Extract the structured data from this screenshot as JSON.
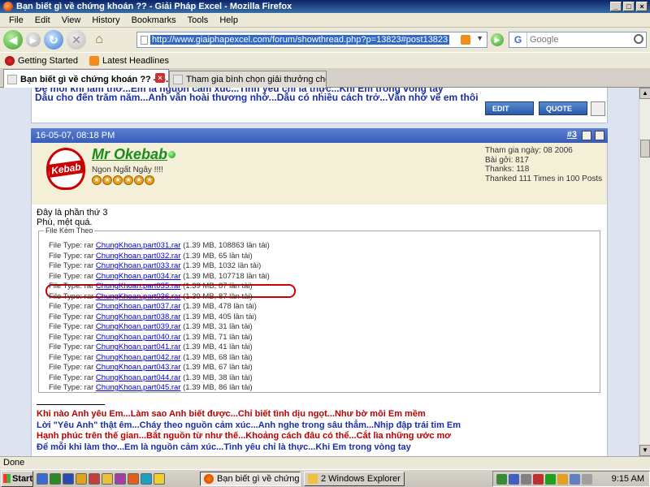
{
  "window": {
    "title": "Bạn biết gì về chứng khoán ?? - Giải Pháp Excel - Mozilla Firefox",
    "controls": [
      "_",
      "□",
      "×"
    ]
  },
  "menu": [
    "File",
    "Edit",
    "View",
    "History",
    "Bookmarks",
    "Tools",
    "Help"
  ],
  "nav": {
    "url": "http://www.giaiphapexcel.com/forum/showthread.php?p=13823#post13823",
    "search_placeholder": "Google",
    "search_engine_letter": "G"
  },
  "bookmarks": [
    {
      "label": "Getting Started",
      "icon": "firefox-icon"
    },
    {
      "label": "Latest Headlines",
      "icon": "rss-icon"
    }
  ],
  "tabs": [
    {
      "label": "Bạn biết gì về chứng khoán ?? - G...",
      "active": true
    },
    {
      "label": "Tham gia bình chọn giải thưởng cho ng...",
      "active": false
    }
  ],
  "previous_post": {
    "sig_line1": "Để mỗi khi làm thơ...Em là nguồn cảm xúc...Tình yêu chỉ là thực...Khi Em trong vòng tay",
    "sig_line2": "Dẫu cho đến trăm năm...Anh vẫn hoài thương nhớ...Dẫu có nhiều cách trở...Vẫn nhớ về em thôi",
    "edit_label": "EDIT",
    "quote_label": "QUOTE"
  },
  "post": {
    "datetime": "16-05-07, 08:18 PM",
    "number": "#3",
    "username": "Mr Okebab",
    "user_title": "Ngon Ngất Ngây !!!!",
    "logo_text": "Kebab",
    "stars": 6,
    "stats": [
      "Tham gia ngày: 08 2006",
      "Bài gởi: 817",
      "Thanks: 118",
      "Thanked 111 Times in 100 Posts"
    ],
    "message_line1": "Đây là phần thứ 3",
    "message_line2": "Phù, mệt quá.",
    "attachments_legend": "File Kèm Theo",
    "file_type_label": "File Type: rar",
    "attachments": [
      {
        "name": "ChungKhoan.part031.rar",
        "info": "(1.39 MB, 108863 lần tải)"
      },
      {
        "name": "ChungKhoan.part032.rar",
        "info": "(1.39 MB, 65 lần tải)"
      },
      {
        "name": "ChungKhoan.part033.rar",
        "info": "(1.39 MB, 1032 lần tải)"
      },
      {
        "name": "ChungKhoan.part034.rar",
        "info": "(1.39 MB, 107718 lần tải)"
      },
      {
        "name": "ChungKhoan.part035.rar",
        "info": "(1.39 MB, 87 lần tải)"
      },
      {
        "name": "ChungKhoan.part036.rar",
        "info": "(1.39 MB, 87 lần tải)"
      },
      {
        "name": "ChungKhoan.part037.rar",
        "info": "(1.39 MB, 478 lần tải)"
      },
      {
        "name": "ChungKhoan.part038.rar",
        "info": "(1.39 MB, 405 lần tải)"
      },
      {
        "name": "ChungKhoan.part039.rar",
        "info": "(1.39 MB, 31 lần tải)"
      },
      {
        "name": "ChungKhoan.part040.rar",
        "info": "(1.39 MB, 71 lần tải)"
      },
      {
        "name": "ChungKhoan.part041.rar",
        "info": "(1.39 MB, 41 lần tải)"
      },
      {
        "name": "ChungKhoan.part042.rar",
        "info": "(1.39 MB, 68 lần tải)"
      },
      {
        "name": "ChungKhoan.part043.rar",
        "info": "(1.39 MB, 67 lần tải)"
      },
      {
        "name": "ChungKhoan.part044.rar",
        "info": "(1.39 MB, 38 lần tải)"
      },
      {
        "name": "ChungKhoan.part045.rar",
        "info": "(1.39 MB, 86 lần tải)"
      }
    ],
    "highlighted_attachment_index": 3,
    "signature": [
      {
        "text": "Khi nào Anh yêu Em...Làm sao Anh biết được...Chỉ biết tình dịu ngọt...Như bờ môi Em mềm",
        "color": "red"
      },
      {
        "text": "Lời \"Yêu Anh\" thật êm...Cháy theo nguồn cảm xúc...Anh nghe trong sâu thẳm...Nhịp đập trái tim Em",
        "color": "blue"
      },
      {
        "text": "Hạnh phúc trên thế gian...Bắt nguồn từ như thế...Khoảng cách đâu có thể...Cắt lìa những ước mơ",
        "color": "red"
      },
      {
        "text": "Để mỗi khi làm thơ...Em là nguồn cảm xúc...Tình yêu chỉ là thực...Khi Em trong vòng tay",
        "color": "blue"
      }
    ]
  },
  "status": "Done",
  "taskbar": {
    "start_label": "Start",
    "buttons": [
      {
        "label": "Bạn biết gì về chứng ...",
        "active": true
      },
      {
        "label": "2 Windows Explorer",
        "active": false
      }
    ],
    "clock": "9:15 AM"
  },
  "colors": {
    "post_header": "#3a5eb8",
    "username_green": "#1a8a1a",
    "sig_red": "#bb0000",
    "sig_blue": "#1a2ea8",
    "highlight_red": "#cc0000"
  }
}
